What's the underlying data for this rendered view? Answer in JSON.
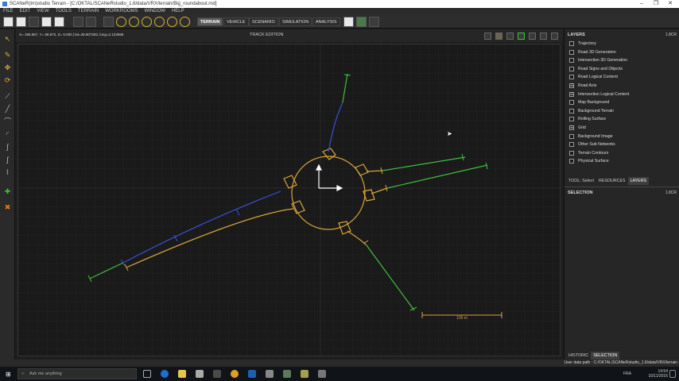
{
  "window": {
    "title": "SCANeR(tm)studio Terrain - [C:/OKTAL/SCANeRstudio_1.6/data/VRX/terrain/Big_roundabout.rnd]",
    "controls": [
      "–",
      "❐",
      "✕"
    ]
  },
  "menu": [
    "FILE",
    "EDIT",
    "VIEW",
    "TOOLS",
    "TERRAIN",
    "WORKROOMS",
    "WINDOW",
    "HELP"
  ],
  "toolbar": {
    "modes": [
      "TERRAIN",
      "VEHICLE",
      "SCENARIO",
      "SIMULATION",
      "ANALYSIS"
    ],
    "active_mode": "TERRAIN"
  },
  "canvas": {
    "coords": "X= 195.867, Y= 88.872, Z= 0.000 | lat=48.807283, long=2.133558",
    "mode_title": "TRACK EDITION",
    "scale_label": "100 m"
  },
  "layers_panel": {
    "title": "LAYERS",
    "badge": "1.8CR",
    "items": [
      {
        "label": "Trajectory",
        "checked": false
      },
      {
        "label": "Road 3D Generation",
        "checked": false
      },
      {
        "label": "Intersection 3D Generation",
        "checked": false
      },
      {
        "label": "Road Signs and Objects",
        "checked": false
      },
      {
        "label": "Road Logical Content",
        "checked": false
      },
      {
        "label": "Road Axis",
        "checked": true
      },
      {
        "label": "Intersection Logical Content",
        "checked": true
      },
      {
        "label": "Map Background",
        "checked": false
      },
      {
        "label": "Background Terrain",
        "checked": false
      },
      {
        "label": "Rolling Surface",
        "checked": false
      },
      {
        "label": "Grid",
        "checked": true
      },
      {
        "label": "Background Image",
        "checked": false
      },
      {
        "label": "Other Sub Networks",
        "checked": false
      },
      {
        "label": "Terrain Contours",
        "checked": false
      },
      {
        "label": "Physical Surface",
        "checked": false
      }
    ]
  },
  "panel_tabs": [
    "TOOL: Select",
    "RESOURCES",
    "LAYERS"
  ],
  "selection_panel": {
    "title": "SELECTION",
    "badge": "1.8CR"
  },
  "bottom_tabs": [
    "HISTORIC",
    "SELECTION"
  ],
  "statusbar": {
    "user_path": "User data path : C:/OKTAL/SCANeRstudio_1.6/data/VRX/terrain"
  },
  "taskbar": {
    "search_placeholder": "Ask me anything",
    "time": "14:54",
    "date": "16/11/2016",
    "lang": "FRA"
  },
  "colors": {
    "road_yellow": "#d6a53a",
    "road_green": "#3fbf3f",
    "road_blue": "#3b4fd8"
  }
}
